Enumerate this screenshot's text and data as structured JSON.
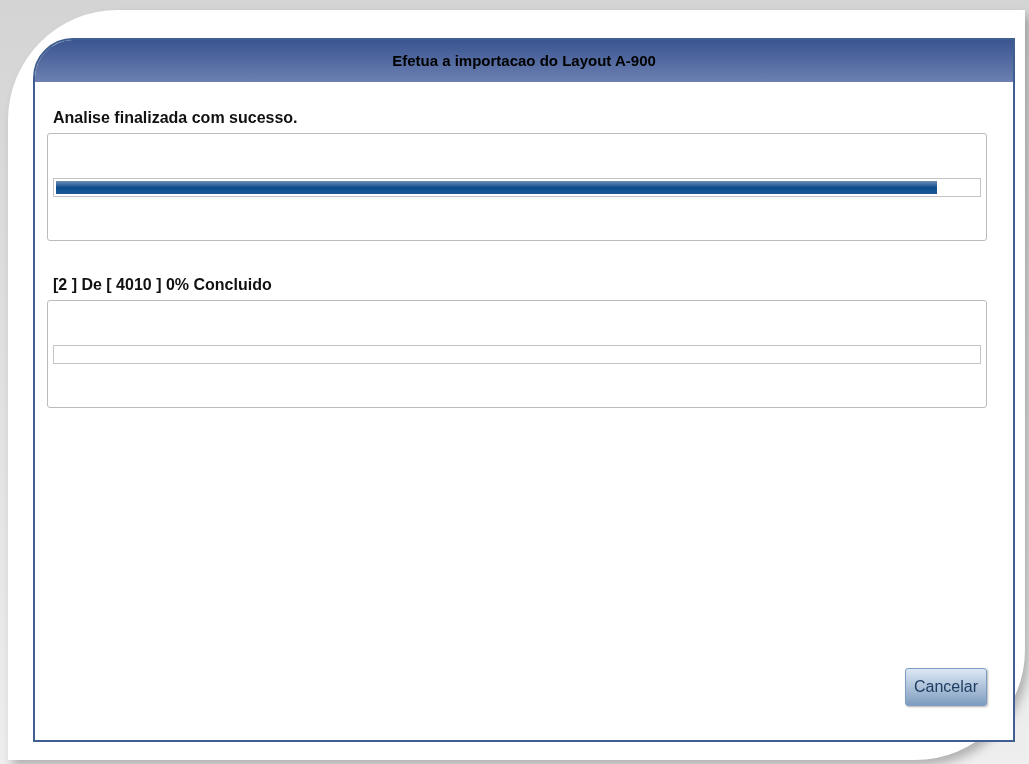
{
  "dialog": {
    "title": "Efetua a importacao do Layout A-900"
  },
  "progress_sections": [
    {
      "label": "Analise finalizada com sucesso.",
      "level": 0.955
    },
    {
      "label": "[2 ] De [ 4010 ] 0% Concluido",
      "level": 0
    }
  ],
  "buttons": [
    {
      "label": "Cancelar"
    }
  ]
}
